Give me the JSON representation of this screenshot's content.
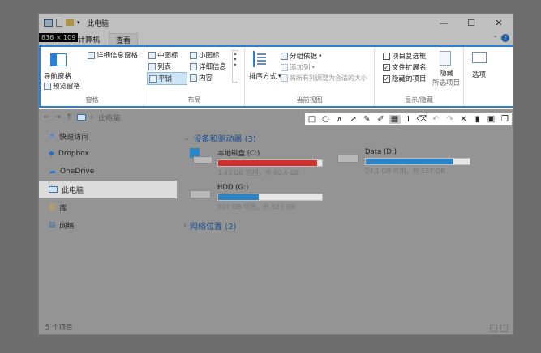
{
  "window": {
    "title": "此电脑",
    "minimize": "—",
    "maximize": "☐",
    "close": "✕"
  },
  "selection": {
    "size_label": "836 × 109"
  },
  "tabs": [
    {
      "label": "计算机"
    },
    {
      "label": "查看"
    }
  ],
  "ribbon": {
    "groups": [
      {
        "label": "窗格"
      },
      {
        "label": "布局"
      },
      {
        "label": "当前视图"
      },
      {
        "label": "显示/隐藏"
      }
    ],
    "pane": {
      "nav_pane": "导航窗格",
      "preview_pane": "预览窗格",
      "details_pane": "详细信息窗格"
    },
    "layout": {
      "medium_icons": "中图标",
      "small_icons": "小图标",
      "list": "列表",
      "details": "详细信息",
      "tiles": "平铺",
      "content": "内容"
    },
    "current_view": {
      "sort_by": "排序方式",
      "group_by": "分组依据",
      "add_column": "添加列",
      "fit_columns": "将所有列调整为合适的大小"
    },
    "show_hide": {
      "item_checkboxes": "项目复选框",
      "file_extensions": "文件扩展名",
      "hidden_items": "隐藏的项目",
      "hide_selected": "隐藏",
      "hide_selected_2": "所选项目",
      "options": "选项"
    }
  },
  "address": {
    "path": "此电脑",
    "arrow": "›"
  },
  "nav": [
    {
      "label": "快速访问"
    },
    {
      "label": "Dropbox"
    },
    {
      "label": "OneDrive"
    },
    {
      "label": "此电脑"
    },
    {
      "label": "库"
    },
    {
      "label": "网络"
    }
  ],
  "devices_section": "设备和驱动器 (3)",
  "network_section": "网络位置 (2)",
  "drives": [
    {
      "name": "本地磁盘 (C:)",
      "info": "3.43 GB 可用，共 80.6 GB",
      "used_fraction": 0.957,
      "bar_color": "#d0312d"
    },
    {
      "name": "Data (D:)",
      "info": "24.1 GB 可用，共 157 GB",
      "used_fraction": 0.846,
      "bar_color": "#2b84c4"
    },
    {
      "name": "HDD (G:)",
      "info": "507 GB 可用，共 833 GB",
      "used_fraction": 0.391,
      "bar_color": "#2b84c4"
    }
  ],
  "status": {
    "items": "5 个项目"
  },
  "colors": {
    "accent": "#2b7fd6",
    "section": "#1e4f91"
  }
}
